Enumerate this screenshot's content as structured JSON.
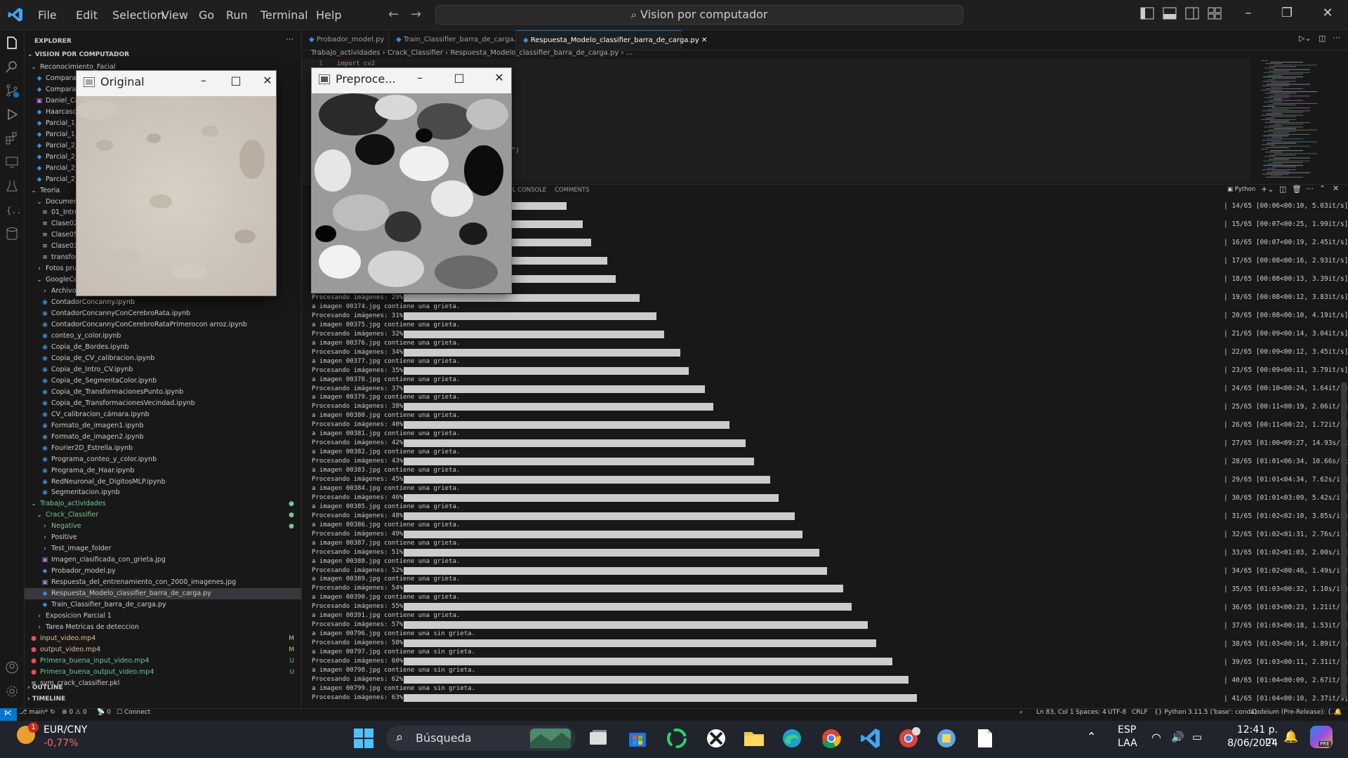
{
  "menu": [
    "File",
    "Edit",
    "Selection",
    "View",
    "Go",
    "Run",
    "Terminal",
    "Help"
  ],
  "command_center": "Vision por computador",
  "explorer": {
    "title": "EXPLORER",
    "root": "VISION POR COMPUTADOR",
    "rows": [
      {
        "label": "Reconocimiento_Facial",
        "indent": 0,
        "kind": "folder-open"
      },
      {
        "label": "Compara_",
        "indent": 1,
        "kind": "py"
      },
      {
        "label": "Compara_",
        "indent": 1,
        "kind": "py"
      },
      {
        "label": "Daniel_Cal",
        "indent": 1,
        "kind": "img"
      },
      {
        "label": "Haarcasca",
        "indent": 1,
        "kind": "py"
      },
      {
        "label": "Parcial_1_v",
        "indent": 1,
        "kind": "py"
      },
      {
        "label": "Parcial_1_v",
        "indent": 1,
        "kind": "py"
      },
      {
        "label": "Parcial_2_v",
        "indent": 1,
        "kind": "py"
      },
      {
        "label": "Parcial_2_v",
        "indent": 1,
        "kind": "py"
      },
      {
        "label": "Parcial_2_v",
        "indent": 1,
        "kind": "py"
      },
      {
        "label": "Parcial_2_v",
        "indent": 1,
        "kind": "py"
      },
      {
        "label": "Teoria",
        "indent": 0,
        "kind": "folder-open"
      },
      {
        "label": "Document",
        "indent": 1,
        "kind": "folder-open"
      },
      {
        "label": "01_Intro",
        "indent": 2,
        "kind": "file"
      },
      {
        "label": "Clase02.p",
        "indent": 2,
        "kind": "file"
      },
      {
        "label": "Clase05.p",
        "indent": 2,
        "kind": "file"
      },
      {
        "label": "Clase03Cl",
        "indent": 2,
        "kind": "file"
      },
      {
        "label": "transform",
        "indent": 2,
        "kind": "file"
      },
      {
        "label": "Fotos prue",
        "indent": 1,
        "kind": "folder"
      },
      {
        "label": "GoogleCol",
        "indent": 1,
        "kind": "folder-open"
      },
      {
        "label": "Archivos",
        "indent": 2,
        "kind": "folder"
      },
      {
        "label": "ContadorConcanny.ipynb",
        "indent": 2,
        "kind": "nb"
      },
      {
        "label": "ContadorConcannyConCerebroRata.ipynb",
        "indent": 2,
        "kind": "nb"
      },
      {
        "label": "ContadorConcannyConCerebroRataPrimerocon arroz.ipynb",
        "indent": 2,
        "kind": "nb"
      },
      {
        "label": "conteo_y_color.ipynb",
        "indent": 2,
        "kind": "nb"
      },
      {
        "label": "Copia_de_Bordes.ipynb",
        "indent": 2,
        "kind": "nb"
      },
      {
        "label": "Copia_de_CV_calibracion.ipynb",
        "indent": 2,
        "kind": "nb"
      },
      {
        "label": "Copia_de_Intro_CV.ipynb",
        "indent": 2,
        "kind": "nb"
      },
      {
        "label": "Copia_de_SegmentaColor.ipynb",
        "indent": 2,
        "kind": "nb"
      },
      {
        "label": "Copia_de_TransformacionesPunto.ipynb",
        "indent": 2,
        "kind": "nb"
      },
      {
        "label": "Copia_de_TransformacionesVecindad.ipynb",
        "indent": 2,
        "kind": "nb"
      },
      {
        "label": "CV_calibracion_cámara.ipynb",
        "indent": 2,
        "kind": "nb"
      },
      {
        "label": "Formato_de_imagen1.ipynb",
        "indent": 2,
        "kind": "nb"
      },
      {
        "label": "Formato_de_imagen2.ipynb",
        "indent": 2,
        "kind": "nb"
      },
      {
        "label": "Fourier2D_Estrella.ipynb",
        "indent": 2,
        "kind": "nb"
      },
      {
        "label": "Programa_conteo_y_color.ipynb",
        "indent": 2,
        "kind": "nb"
      },
      {
        "label": "Programa_de_Haar.ipynb",
        "indent": 2,
        "kind": "nb"
      },
      {
        "label": "RedNeuronal_de_DigitosMLP.ipynb",
        "indent": 2,
        "kind": "nb"
      },
      {
        "label": "Segmentacion.ipynb",
        "indent": 2,
        "kind": "nb"
      },
      {
        "label": "Trabajo_actividades",
        "indent": 0,
        "kind": "folder-open",
        "color": "#73c991",
        "dot": true
      },
      {
        "label": "Crack_Classifier",
        "indent": 1,
        "kind": "folder-open",
        "color": "#73c991",
        "dot": true
      },
      {
        "label": "Negative",
        "indent": 2,
        "kind": "folder",
        "color": "#73c991",
        "dot": true
      },
      {
        "label": "Positive",
        "indent": 2,
        "kind": "folder"
      },
      {
        "label": "Test_image_folder",
        "indent": 2,
        "kind": "folder"
      },
      {
        "label": "Imagen_clasificada_con_grieta.jpg",
        "indent": 2,
        "kind": "img"
      },
      {
        "label": "Probador_model.py",
        "indent": 2,
        "kind": "py"
      },
      {
        "label": "Respuesta_del_entrenamiento_con_2000_imagenes.jpg",
        "indent": 2,
        "kind": "img"
      },
      {
        "label": "Respuesta_Modelo_classifier_barra_de_carga.py",
        "indent": 2,
        "kind": "py",
        "selected": true
      },
      {
        "label": "Train_Classifier_barra_de_carga.py",
        "indent": 2,
        "kind": "py"
      },
      {
        "label": "Exposicion Parcial 1",
        "indent": 1,
        "kind": "folder"
      },
      {
        "label": "Tarea Metricas de deteccion",
        "indent": 1,
        "kind": "folder"
      },
      {
        "label": "input_video.mp4",
        "indent": 0,
        "kind": "vid",
        "color": "#e2c08d",
        "badge": "M"
      },
      {
        "label": "output_video.mp4",
        "indent": 0,
        "kind": "vid",
        "color": "#e2c08d",
        "badge": "M"
      },
      {
        "label": "Primera_buena_input_video.mp4",
        "indent": 0,
        "kind": "vid",
        "color": "#73c991",
        "badge": "U"
      },
      {
        "label": "Primera_buena_output_video.mp4",
        "indent": 0,
        "kind": "vid",
        "color": "#73c991",
        "badge": "U"
      },
      {
        "label": "svm_crack_classifier.pkl",
        "indent": 0,
        "kind": "file"
      }
    ],
    "outline": "OUTLINE",
    "timeline": "TIMELINE"
  },
  "tabs": [
    {
      "label": "Probador_model.py",
      "active": false
    },
    {
      "label": "Train_Classifier_barra_de_carga.py",
      "active": false
    },
    {
      "label": "Respuesta_Modelo_classifier_barra_de_carga.py",
      "active": true
    }
  ],
  "breadcrumb": [
    "Trabajo_actividades",
    "Crack_Classifier",
    "Respuesta_Modelo_classifier_barra_de_carga.py",
    "..."
  ],
  "editor": {
    "line_no": "1",
    "code": "import cv2",
    "fragment": "\")"
  },
  "panel_tabs": [
    "DEBUG CONSOLE",
    "COMMENTS"
  ],
  "panel_tabs_visible": [
    "OL CONSOLE",
    "COMMENTS"
  ],
  "terminal_profile": "Python",
  "terminal": [
    {
      "t": "Procesando imágenes:  29%",
      "p": 29
    },
    {
      "t": "a imagen 00374.jpg contiene una grieta."
    },
    {
      "t": "Procesando imágenes:  31%",
      "p": 31
    },
    {
      "t": "a imagen 00375.jpg contiene una grieta."
    },
    {
      "t": "Procesando imágenes:  32%",
      "p": 32
    },
    {
      "t": "a imagen 00376.jpg contiene una grieta."
    },
    {
      "t": "Procesando imágenes:  34%",
      "p": 34
    },
    {
      "t": "a imagen 00377.jpg contiene una grieta."
    },
    {
      "t": "Procesando imágenes:  35%",
      "p": 35
    },
    {
      "t": "a imagen 00378.jpg contiene una grieta."
    },
    {
      "t": "Procesando imágenes:  37%",
      "p": 37
    },
    {
      "t": "a imagen 00379.jpg contiene una grieta."
    },
    {
      "t": "Procesando imágenes:  38%",
      "p": 38
    },
    {
      "t": "a imagen 00380.jpg contiene una grieta."
    },
    {
      "t": "Procesando imágenes:  40%",
      "p": 40
    },
    {
      "t": "a imagen 00381.jpg contiene una grieta."
    },
    {
      "t": "Procesando imágenes:  42%",
      "p": 42
    },
    {
      "t": "a imagen 00382.jpg contiene una grieta."
    },
    {
      "t": "Procesando imágenes:  43%",
      "p": 43
    },
    {
      "t": "a imagen 00383.jpg contiene una grieta."
    },
    {
      "t": "Procesando imágenes:  45%",
      "p": 45
    },
    {
      "t": "a imagen 00384.jpg contiene una grieta."
    },
    {
      "t": "Procesando imágenes:  46%",
      "p": 46
    },
    {
      "t": "a imagen 00385.jpg contiene una grieta."
    },
    {
      "t": "Procesando imágenes:  48%",
      "p": 48
    },
    {
      "t": "a imagen 00386.jpg contiene una grieta."
    },
    {
      "t": "Procesando imágenes:  49%",
      "p": 49
    },
    {
      "t": "a imagen 00387.jpg contiene una grieta."
    },
    {
      "t": "Procesando imágenes:  51%",
      "p": 51
    },
    {
      "t": "a imagen 00388.jpg contiene una grieta."
    },
    {
      "t": "Procesando imágenes:  52%",
      "p": 52
    },
    {
      "t": "a imagen 00389.jpg contiene una grieta."
    },
    {
      "t": "Procesando imágenes:  54%",
      "p": 54
    },
    {
      "t": "a imagen 00390.jpg contiene una grieta."
    },
    {
      "t": "Procesando imágenes:  55%",
      "p": 55
    },
    {
      "t": "a imagen 00391.jpg contiene una grieta."
    },
    {
      "t": "Procesando imágenes:  57%",
      "p": 57
    },
    {
      "t": "a imagen 00796.jpg contiene una sin grieta."
    },
    {
      "t": "Procesando imágenes:  58%",
      "p": 58
    },
    {
      "t": "a imagen 00797.jpg contiene una sin grieta."
    },
    {
      "t": "Procesando imágenes:  60%",
      "p": 60
    },
    {
      "t": "a imagen 00798.jpg contiene una sin grieta."
    },
    {
      "t": "Procesando imágenes:  62%",
      "p": 62
    },
    {
      "t": "a imagen 00799.jpg contiene una sin grieta."
    },
    {
      "t": "Procesando imágenes:  63%",
      "p": 63
    }
  ],
  "upper_bars": [
    {
      "p": 20
    },
    {
      "p": 22
    },
    {
      "p": 23
    },
    {
      "p": 25
    },
    {
      "p": 26
    }
  ],
  "stats": [
    "| 14/65 [00:06<00:10,  5.03it/s]L",
    "| 15/65 [00:07<00:25,  1.99it/s]L",
    "| 16/65 [00:07<00:19,  2.45it/s]L",
    "| 17/65 [00:08<00:16,  2.93it/s]L",
    "| 18/65 [00:08<00:13,  3.39it/s]L",
    "| 19/65 [00:08<00:12,  3.83it/s]L",
    "| 20/65 [00:08<00:10,  4.19it/s]L",
    "| 21/65 [00:09<00:14,  3.04it/s]L",
    "| 22/65 [00:09<00:12,  3.45it/s]L",
    "| 23/65 [00:09<00:11,  3.79it/s]L",
    "| 24/65 [00:10<00:24,  1.64it/s]L",
    "| 25/65 [00:11<00:19,  2.06it/s]L",
    "| 26/65 [00:11<00:22,  1.72it/s]L",
    "| 27/65 [01:00<09:27, 14.93s/it]L",
    "| 28/65 [01:01<06:34, 10.66s/it]L",
    "| 29/65 [01:01<04:34,  7.62s/it]L",
    "| 30/65 [01:01<03:09,  5.42s/it]L",
    "| 31/65 [01:02<02:10,  3.85s/it]L",
    "| 32/65 [01:02<01:31,  2.76s/it]L",
    "| 33/65 [01:02<01:03,  2.00s/it]L",
    "| 34/65 [01:02<00:46,  1.49s/it]L",
    "| 35/65 [01:03<00:32,  1.10s/it]L",
    "| 36/65 [01:03<00:23,  1.21it/s]L",
    "| 37/65 [01:03<00:18,  1.53it/s]L",
    "| 38/65 [01:03<00:14,  1.89it/s]L",
    "| 39/65 [01:03<00:11,  2.31it/s]L",
    "| 40/65 [01:04<00:09,  2.67it/s]L",
    "| 41/65 [01:04<00:10,  2.37it/s]L"
  ],
  "windows": {
    "original": {
      "title": "Original"
    },
    "preprocessed": {
      "title": "Preproce..."
    }
  },
  "status": {
    "branch": "main*",
    "problems": "0",
    "warnings": "0",
    "ports": "0",
    "connect": "Connect",
    "position": "Ln 83, Col 1",
    "spaces": "Spaces: 4",
    "encoding": "UTF-8",
    "eol": "CRLF",
    "language": "Python",
    "interpreter": "3.11.5 ('base': conda)",
    "codeium": "Codeium (Pre-Release): {...}"
  },
  "taskbar": {
    "weather_badge": "1",
    "ticker": "EUR/CNY",
    "change": "-0,77%",
    "search": "Búsqueda",
    "lang1": "ESP",
    "lang2": "LAA",
    "time": "12:41 p. m.",
    "date": "8/06/2024",
    "copilot_badge": "PRE"
  },
  "colors": {
    "accent": "#0078d4",
    "git_added": "#73c991",
    "git_modified": "#e2c08d",
    "deleted": "#f14c4c"
  }
}
